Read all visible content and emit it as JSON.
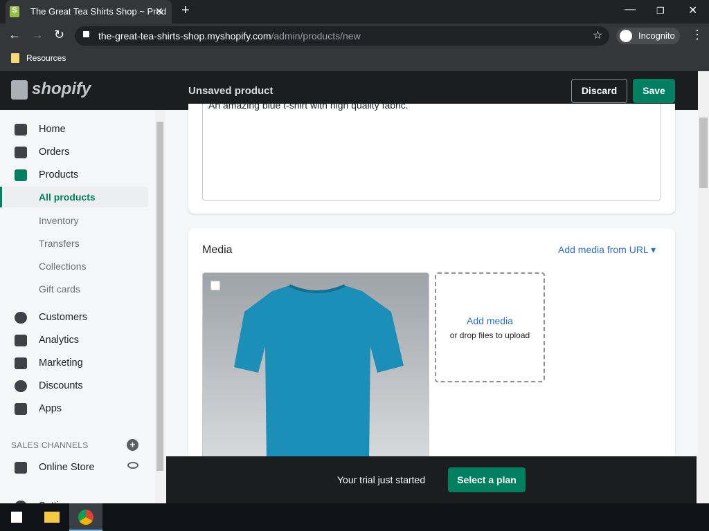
{
  "browser": {
    "tab_title": "The Great Tea Shirts Shop ~ Prod",
    "url_host": "the-great-tea-shirts-shop.myshopify.com",
    "url_path": "/admin/products/new",
    "incognito_label": "Incognito",
    "bookmark": "Resources"
  },
  "topbar": {
    "logo": "shopify",
    "title": "Unsaved product",
    "discard": "Discard",
    "save": "Save"
  },
  "sidebar": {
    "items": [
      {
        "label": "Home"
      },
      {
        "label": "Orders"
      },
      {
        "label": "Products"
      },
      {
        "label": "All products"
      },
      {
        "label": "Inventory"
      },
      {
        "label": "Transfers"
      },
      {
        "label": "Collections"
      },
      {
        "label": "Gift cards"
      },
      {
        "label": "Customers"
      },
      {
        "label": "Analytics"
      },
      {
        "label": "Marketing"
      },
      {
        "label": "Discounts"
      },
      {
        "label": "Apps"
      }
    ],
    "channels_heading": "SALES CHANNELS",
    "online_store": "Online Store",
    "settings": "Settings"
  },
  "description": "An amazing blue t-shirt with high quality fabric.",
  "media": {
    "heading": "Media",
    "add_from_url": "Add media from URL",
    "add_media": "Add media",
    "drop_text": "or drop files to upload"
  },
  "trial": {
    "text": "Your trial just started",
    "button": "Select a plan"
  },
  "colors": {
    "accent": "#008060",
    "link": "#2c6ecb",
    "shirt": "#1b8fb8"
  }
}
